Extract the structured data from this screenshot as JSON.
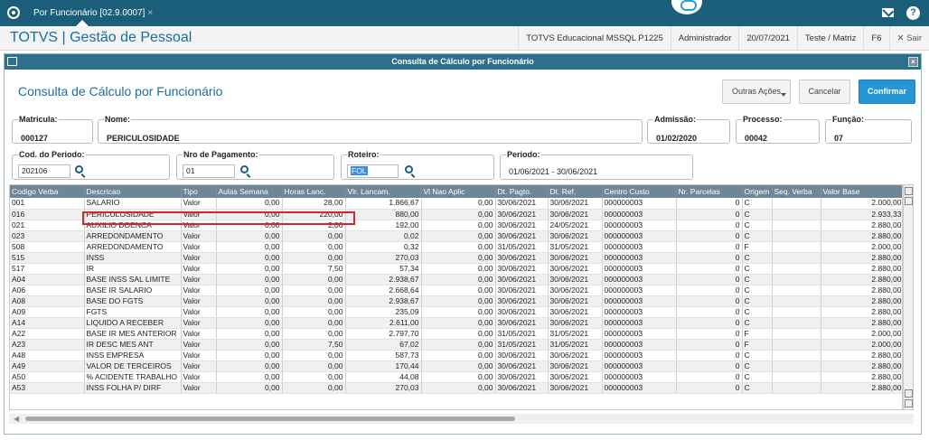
{
  "topbar": {
    "tab_label": "Por Funcionário [02.9.0007]",
    "tab_close": "×"
  },
  "app": {
    "title": "TOTVS | Gestão de Pessoal",
    "company": "TOTVS Educacional MSSQL P1225",
    "user": "Administrador",
    "date": "20/07/2021",
    "branch": "Teste / Matriz",
    "f6": "F6",
    "exit": "✕ Sair"
  },
  "window": {
    "title": "Consulta de Cálculo por Funcionário",
    "close": "×"
  },
  "form": {
    "title": "Consulta de Cálculo por Funcionário",
    "buttons": {
      "other": "Outras Ações",
      "cancel": "Cancelar",
      "confirm": "Confirmar"
    },
    "fields": {
      "matricula": {
        "label": "Matricula:",
        "value": "000127"
      },
      "nome": {
        "label": "Nome:",
        "value": "PERICULOSIDADE"
      },
      "admissao": {
        "label": "Admissão:",
        "value": "01/02/2020"
      },
      "processo": {
        "label": "Processo:",
        "value": "00042"
      },
      "funcao": {
        "label": "Função:",
        "value": "07"
      },
      "cod_periodo": {
        "label": "Cod. do Periodo:",
        "value": "202106"
      },
      "nro_pagamento": {
        "label": "Nro de Pagamento:",
        "value": "01"
      },
      "roteiro": {
        "label": "Roteiro:",
        "value": "FOL"
      },
      "periodo": {
        "label": "Periodo:",
        "value": "01/06/2021 - 30/06/2021"
      }
    }
  },
  "grid": {
    "columns": [
      "Codigo Verba",
      "Descricao",
      "Tipo",
      "Aulas Semana",
      "Horas Lanc.",
      "Vlr. Lancam.",
      "Vl Nao Aplic",
      "Dt. Pagto.",
      "Dt. Ref.",
      "Centro Custo",
      "Nr. Parcelas",
      "Origem",
      "Seq. Verba",
      "Valor Base"
    ],
    "rows": [
      [
        "001",
        "SALARIO",
        "Valor",
        "0,00",
        "28,00",
        "1.866,67",
        "0,00",
        "30/06/2021",
        "30/06/2021",
        "000000003",
        "0",
        "C",
        "",
        "2.000,00"
      ],
      [
        "016",
        "PERICULOSIDADE",
        "Valor",
        "0,00",
        "220,00",
        "880,00",
        "0,00",
        "30/06/2021",
        "30/06/2021",
        "000000003",
        "0",
        "C",
        "",
        "2.933,33"
      ],
      [
        "021",
        "AUXILIO DOENCA",
        "Valor",
        "0,00",
        "2,00",
        "192,00",
        "0,00",
        "30/06/2021",
        "24/05/2021",
        "000000003",
        "0",
        "C",
        "",
        "2.880,00"
      ],
      [
        "023",
        "ARREDONDAMENTO",
        "Valor",
        "0,00",
        "0,00",
        "0,02",
        "0,00",
        "30/06/2021",
        "30/06/2021",
        "000000003",
        "0",
        "C",
        "",
        "2.880,00"
      ],
      [
        "508",
        "ARREDONDAMENTO",
        "Valor",
        "0,00",
        "0,00",
        "0,32",
        "0,00",
        "31/05/2021",
        "31/05/2021",
        "000000003",
        "0",
        "F",
        "",
        "2.000,00"
      ],
      [
        "515",
        "INSS",
        "Valor",
        "0,00",
        "0,00",
        "270,03",
        "0,00",
        "30/06/2021",
        "30/06/2021",
        "000000003",
        "0",
        "C",
        "",
        "2.880,00"
      ],
      [
        "517",
        "IR",
        "Valor",
        "0,00",
        "7,50",
        "57,34",
        "0,00",
        "30/06/2021",
        "30/06/2021",
        "000000003",
        "0",
        "C",
        "",
        "2.880,00"
      ],
      [
        "A04",
        "BASE INSS SAL LIMITE",
        "Valor",
        "0,00",
        "0,00",
        "2.938,67",
        "0,00",
        "30/06/2021",
        "30/06/2021",
        "000000003",
        "0",
        "C",
        "",
        "2.880,00"
      ],
      [
        "A06",
        "BASE IR SALARIO",
        "Valor",
        "0,00",
        "0,00",
        "2.668,64",
        "0,00",
        "30/06/2021",
        "30/06/2021",
        "000000003",
        "0",
        "C",
        "",
        "2.880,00"
      ],
      [
        "A08",
        "BASE DO FGTS",
        "Valor",
        "0,00",
        "0,00",
        "2.938,67",
        "0,00",
        "30/06/2021",
        "30/06/2021",
        "000000003",
        "0",
        "C",
        "",
        "2.880,00"
      ],
      [
        "A09",
        "FGTS",
        "Valor",
        "0,00",
        "0,00",
        "235,09",
        "0,00",
        "30/06/2021",
        "30/06/2021",
        "000000003",
        "0",
        "C",
        "",
        "2.880,00"
      ],
      [
        "A14",
        "LIQUIDO A RECEBER",
        "Valor",
        "0,00",
        "0,00",
        "2.611,00",
        "0,00",
        "30/06/2021",
        "30/06/2021",
        "000000003",
        "0",
        "C",
        "",
        "2.880,00"
      ],
      [
        "A22",
        "BASE IR MES ANTERIOR",
        "Valor",
        "0,00",
        "0,00",
        "2.797,70",
        "0,00",
        "31/05/2021",
        "31/05/2021",
        "000000003",
        "0",
        "F",
        "",
        "2.000,00"
      ],
      [
        "A23",
        "IR DESC MES ANT",
        "Valor",
        "0,00",
        "7,50",
        "67,02",
        "0,00",
        "31/05/2021",
        "31/05/2021",
        "000000003",
        "0",
        "F",
        "",
        "2.000,00"
      ],
      [
        "A48",
        "INSS EMPRESA",
        "Valor",
        "0,00",
        "0,00",
        "587,73",
        "0,00",
        "30/06/2021",
        "30/06/2021",
        "000000003",
        "0",
        "C",
        "",
        "2.880,00"
      ],
      [
        "A49",
        "VALOR DE TERCEIROS",
        "Valor",
        "0,00",
        "0,00",
        "170,44",
        "0,00",
        "30/06/2021",
        "30/06/2021",
        "000000003",
        "0",
        "C",
        "",
        "2.880,00"
      ],
      [
        "A50",
        "% ACIDENTE TRABALHO",
        "Valor",
        "0,00",
        "0,00",
        "44,08",
        "0,00",
        "30/06/2021",
        "30/06/2021",
        "000000003",
        "0",
        "C",
        "",
        "2.880,00"
      ],
      [
        "A53",
        "INSS FOLHA P/ DIRF",
        "Valor",
        "0,00",
        "0,00",
        "270,03",
        "0,00",
        "30/06/2021",
        "30/06/2021",
        "000000003",
        "0",
        "C",
        "",
        "2.880,00"
      ]
    ]
  },
  "colors": {
    "topbar": "#1b5e7a",
    "accent": "#2596d1",
    "header": "#6d8797",
    "highlight": "#d4242d"
  }
}
